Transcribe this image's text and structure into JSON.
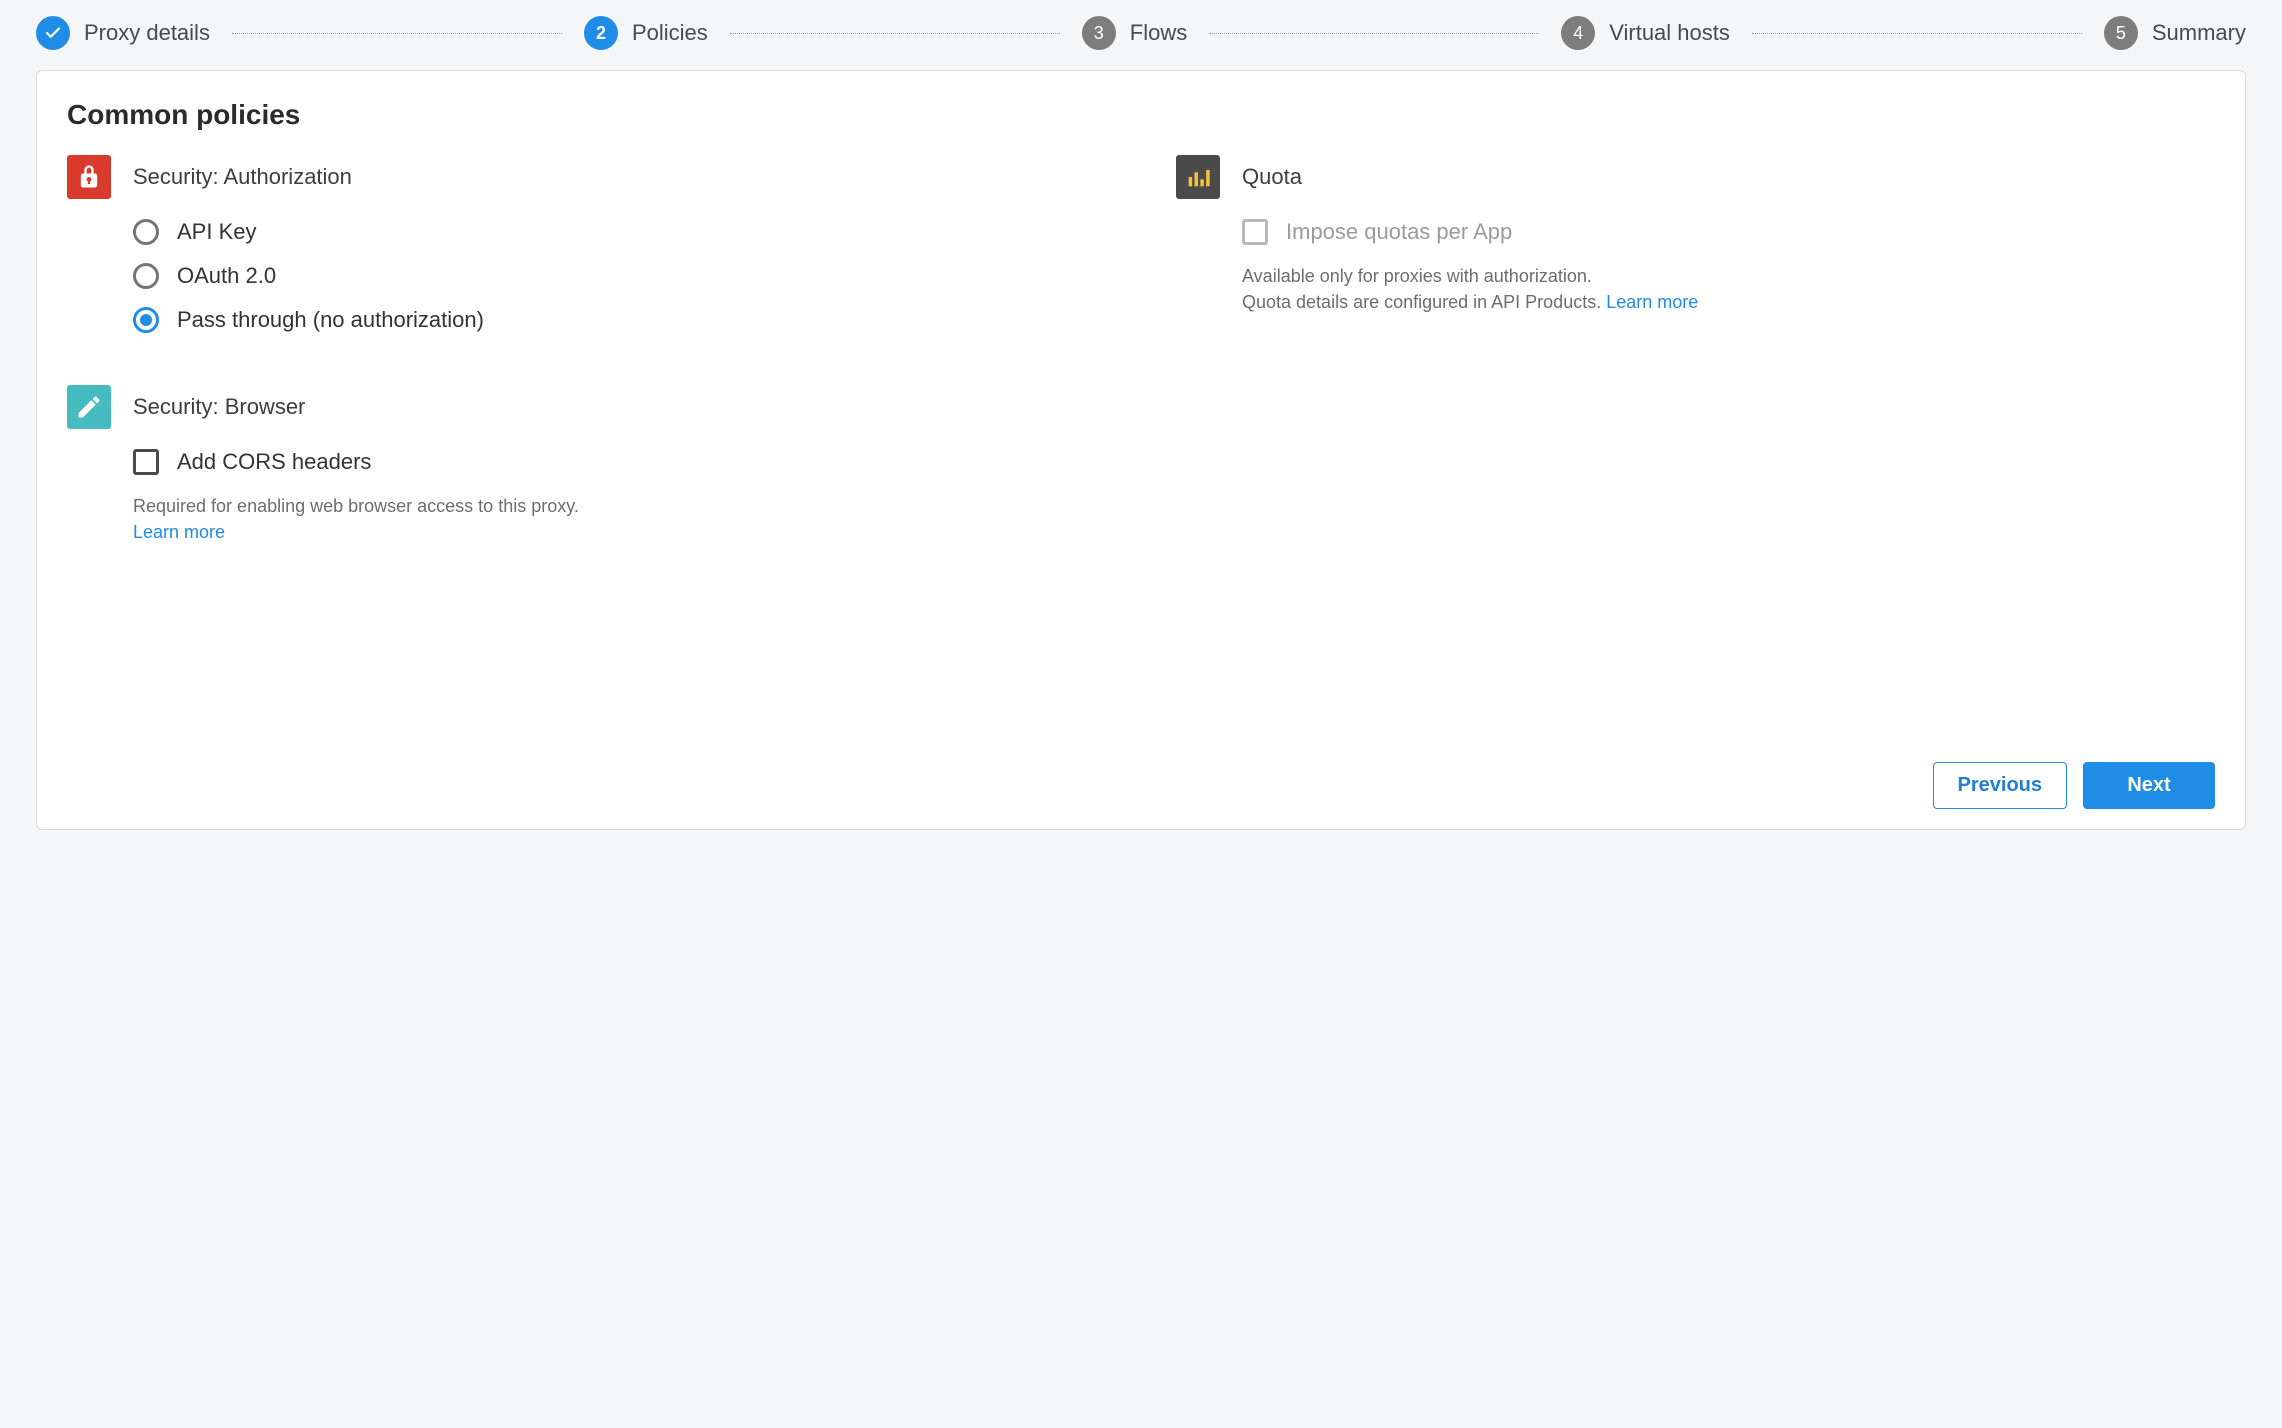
{
  "stepper": {
    "steps": [
      {
        "label": "Proxy details",
        "state": "completed"
      },
      {
        "label": "Policies",
        "state": "current",
        "number": "2"
      },
      {
        "label": "Flows",
        "state": "upcoming",
        "number": "3"
      },
      {
        "label": "Virtual hosts",
        "state": "upcoming",
        "number": "4"
      },
      {
        "label": "Summary",
        "state": "upcoming",
        "number": "5"
      }
    ]
  },
  "page": {
    "heading": "Common policies"
  },
  "security_auth": {
    "title": "Security: Authorization",
    "options": {
      "api_key": {
        "label": "API Key",
        "selected": false
      },
      "oauth": {
        "label": "OAuth 2.0",
        "selected": false
      },
      "pass_through": {
        "label": "Pass through (no authorization)",
        "selected": true
      }
    }
  },
  "quota": {
    "title": "Quota",
    "checkbox_label": "Impose quotas per App",
    "enabled": false,
    "helper_line1": "Available only for proxies with authorization.",
    "helper_line2": "Quota details are configured in API Products.",
    "learn_more": "Learn more"
  },
  "security_browser": {
    "title": "Security: Browser",
    "checkbox_label": "Add CORS headers",
    "helper": "Required for enabling web browser access to this proxy.",
    "learn_more": "Learn more"
  },
  "footer": {
    "previous": "Previous",
    "next": "Next"
  }
}
